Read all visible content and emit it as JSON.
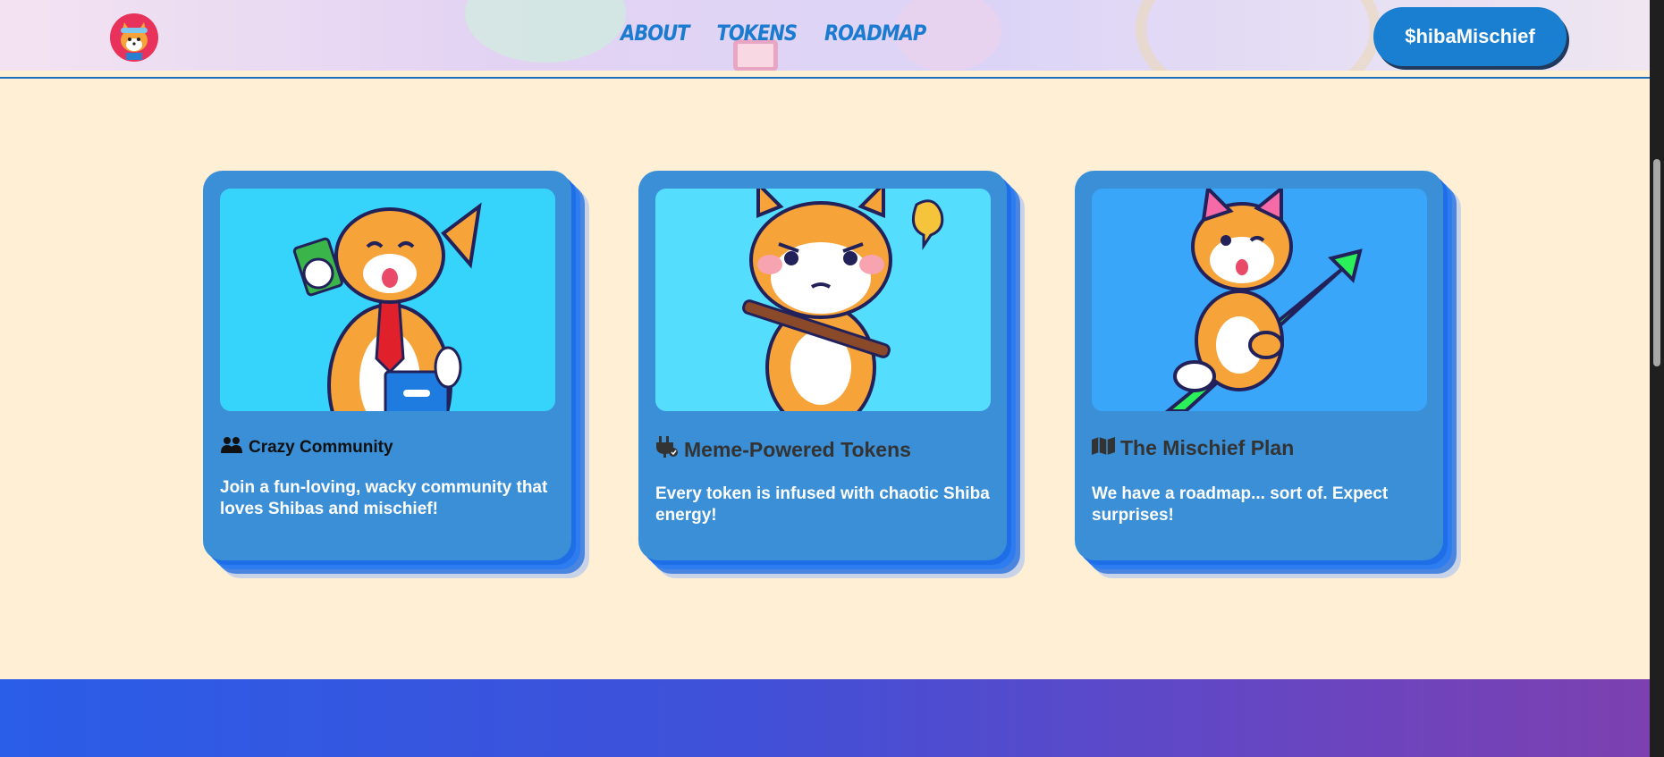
{
  "header": {
    "nav": [
      "ABOUT",
      "TOKENS",
      "ROADMAP"
    ],
    "cta_label": "$hibaMischief"
  },
  "cards": [
    {
      "icon": "users-icon",
      "title": "Crazy Community",
      "text": "Join a fun-loving, wacky community that loves Shibas and mischief!",
      "image_bg": "#36d3fb"
    },
    {
      "icon": "plug-icon",
      "title": "Meme-Powered Tokens",
      "text": "Every token is infused with chaotic Shiba energy!",
      "image_bg": "#55ddfd"
    },
    {
      "icon": "map-icon",
      "title": "The Mischief Plan",
      "text": "We have a roadmap... sort of. Expect surprises!",
      "image_bg": "#3aa6f9"
    }
  ],
  "colors": {
    "page_bg": "#ffefd5",
    "card_bg": "#3a8fd6",
    "accent": "#1a7fd0",
    "shadow_layer": "#1e6ee8"
  }
}
